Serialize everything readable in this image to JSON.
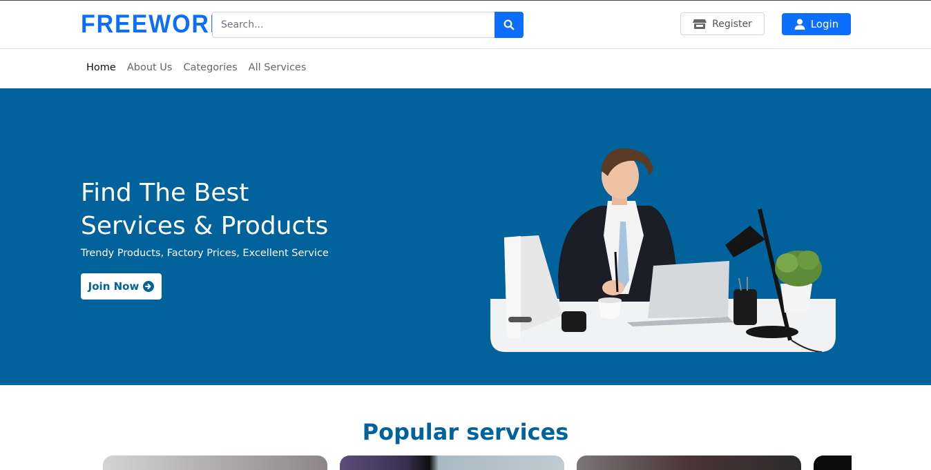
{
  "header": {
    "logo": "FREEWORK",
    "search": {
      "placeholder": "Search...",
      "value": ""
    },
    "register_label": "Register",
    "login_label": "Login"
  },
  "nav": {
    "items": [
      {
        "label": "Home",
        "active": true
      },
      {
        "label": "About Us",
        "active": false
      },
      {
        "label": "Categories",
        "active": false
      },
      {
        "label": "All Services",
        "active": false
      }
    ]
  },
  "hero": {
    "title_line1": "Find The Best",
    "title_line2": "Services & Products",
    "tagline": "Trendy Products, Factory Prices, Excellent Service",
    "cta_label": "Join Now",
    "background_color": "#02629b"
  },
  "popular": {
    "heading": "Popular services"
  },
  "colors": {
    "primary": "#0d6efd",
    "brand_dark": "#02629b"
  },
  "icons": [
    "search-icon",
    "store-icon",
    "user-icon",
    "arrow-circle-right-icon"
  ]
}
